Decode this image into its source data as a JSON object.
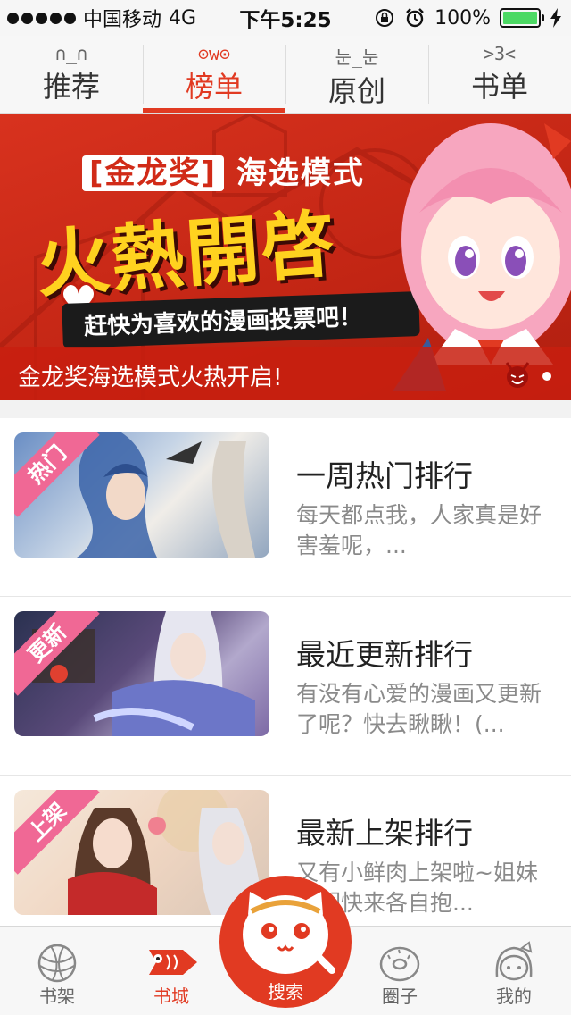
{
  "status_bar": {
    "carrier": "中国移动",
    "network": "4G",
    "time": "下午5:25",
    "battery": "100%"
  },
  "tabs": [
    {
      "emoticon": "∩_∩",
      "label": "推荐"
    },
    {
      "emoticon": "⊙w⊙",
      "label": "榜单"
    },
    {
      "emoticon": "눈_눈",
      "label": "原创"
    },
    {
      "emoticon": ">3<",
      "label": "书单"
    }
  ],
  "banner": {
    "subtitle_tag": "[金龙奖]",
    "subtitle": "海选模式",
    "headline": "火熱開啓",
    "slogan": "赶快为喜欢的漫画投票吧！",
    "caption": "金龙奖海选模式火热开启!"
  },
  "rankings": [
    {
      "tag": "热门",
      "title": "一周热门排行",
      "desc": "每天都点我，人家真是好害羞呢，..."
    },
    {
      "tag": "更新",
      "title": "最近更新排行",
      "desc": "有没有心爱的漫画又更新了呢？快去瞅瞅！(..."
    },
    {
      "tag": "上架",
      "title": "最新上架排行",
      "desc": "又有小鲜肉上架啦~姐妹妹们快来各自抱..."
    }
  ],
  "bottom_nav": {
    "shelf": "书架",
    "store": "书城",
    "search": "搜索",
    "circle": "圈子",
    "mine": "我的"
  },
  "colors": {
    "accent": "#e13a22",
    "ribbon": "#f06895",
    "battery": "#4cd964"
  }
}
